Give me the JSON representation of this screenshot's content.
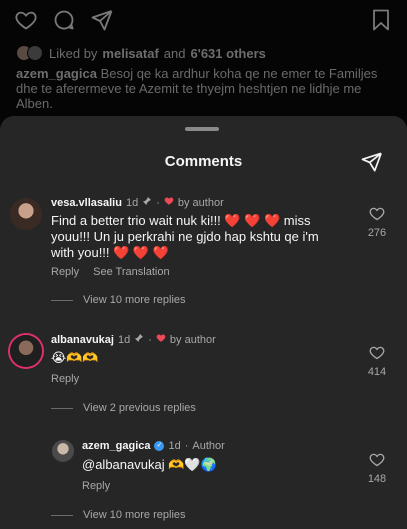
{
  "post": {
    "liked_by_prefix": "Liked by",
    "liked_by_user": "melisataf",
    "liked_by_and": "and",
    "liked_by_others": "6'631 others",
    "caption_user": "azem_gagica",
    "caption_text": "Besoj qe ka ardhur koha qe ne emer te Familjes dhe te aferermeve te Azemit te thyejm heshtjen ne lidhje me Alben."
  },
  "sheet": {
    "title": "Comments"
  },
  "comments": [
    {
      "user": "vesa.vllasaliu",
      "time": "1d",
      "by_author": "by author",
      "text": "Find a better trio wait nuk ki!!! ❤️ ❤️ ❤️  miss youu!!! Un ju perkrahi ne gjdo hap kshtu qe i'm with you!!! ❤️ ❤️ ❤️",
      "reply": "Reply",
      "see_translation": "See Translation",
      "likes": "276",
      "replies_link": "View 10 more replies"
    },
    {
      "user": "albanavukaj",
      "time": "1d",
      "by_author": "by author",
      "text": "😭🫶🫶",
      "reply": "Reply",
      "likes": "414",
      "replies_link": "View 2 previous replies"
    },
    {
      "user": "azem_gagica",
      "time": "1d",
      "author_label": "Author",
      "text": "@albanavukaj 🫶🤍🌍",
      "reply": "Reply",
      "likes": "148",
      "replies_link": "View 10 more replies"
    }
  ],
  "icons": {
    "like": "heart-outline-icon",
    "comment": "comment-bubble-icon",
    "share": "paper-plane-icon",
    "save": "bookmark-icon",
    "pin": "pin-icon",
    "author_heart": "red-heart-icon",
    "verified": "verified-badge-icon"
  },
  "colors": {
    "sheet_bg": "#262626",
    "author_heart": "#ed4956",
    "verified": "#3897f0"
  }
}
